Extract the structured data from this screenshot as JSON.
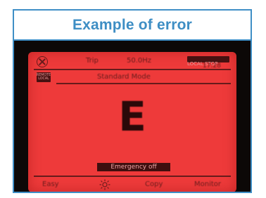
{
  "header": {
    "title": "Example of error"
  },
  "screen": {
    "top_row": {
      "mode_label": "Trip",
      "frequency": "50.0Hz",
      "time": "17:28"
    },
    "badges": {
      "top_right": "LOCAL STOP",
      "left": "REMOTE LOCAL"
    },
    "mode_title": "Standard Mode",
    "error_letter": "E",
    "status_message": "Emergency off",
    "softkeys": [
      "Easy",
      "Copy",
      "Monitor"
    ]
  },
  "colors": {
    "accent": "#3e8ec4",
    "screen": "#ee3a3a",
    "device": "#0c0807"
  },
  "icons": [
    "circle-x-icon",
    "sun-icon"
  ]
}
